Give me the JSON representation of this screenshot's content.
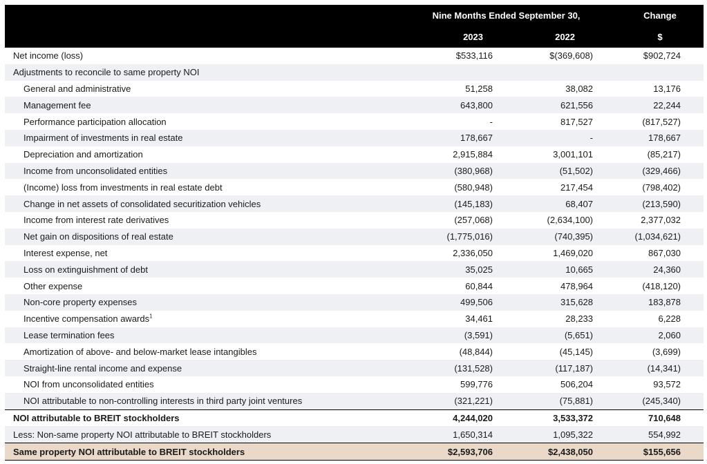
{
  "header": {
    "period_label": "Nine Months Ended September 30,",
    "change_label": "Change",
    "year_1": "2023",
    "year_2": "2022",
    "change_unit": "$"
  },
  "rows": [
    {
      "label": "Net income (loss)",
      "v2023": "$533,116",
      "v2022": "$(369,608)",
      "change": "$902,724"
    },
    {
      "label": "Adjustments to reconcile to same property NOI",
      "v2023": "",
      "v2022": "",
      "change": ""
    },
    {
      "label": "General and administrative",
      "v2023": "51,258",
      "v2022": "38,082",
      "change": "13,176"
    },
    {
      "label": "Management fee",
      "v2023": "643,800",
      "v2022": "621,556",
      "change": "22,244"
    },
    {
      "label": "Performance participation allocation",
      "v2023": "-",
      "v2022": "817,527",
      "change": "(817,527)"
    },
    {
      "label": "Impairment of investments in real estate",
      "v2023": "178,667",
      "v2022": "-",
      "change": "178,667"
    },
    {
      "label": "Depreciation and amortization",
      "v2023": "2,915,884",
      "v2022": "3,001,101",
      "change": "(85,217)"
    },
    {
      "label": "Income from unconsolidated entities",
      "v2023": "(380,968)",
      "v2022": "(51,502)",
      "change": "(329,466)"
    },
    {
      "label": "(Income) loss from investments in real estate debt",
      "v2023": "(580,948)",
      "v2022": "217,454",
      "change": "(798,402)"
    },
    {
      "label": "Change in net assets of consolidated securitization vehicles",
      "v2023": "(145,183)",
      "v2022": "68,407",
      "change": "(213,590)"
    },
    {
      "label": "Income from interest rate derivatives",
      "v2023": "(257,068)",
      "v2022": "(2,634,100)",
      "change": "2,377,032"
    },
    {
      "label": "Net gain on dispositions of real estate",
      "v2023": "(1,775,016)",
      "v2022": "(740,395)",
      "change": "(1,034,621)"
    },
    {
      "label": "Interest expense, net",
      "v2023": "2,336,050",
      "v2022": "1,469,020",
      "change": "867,030"
    },
    {
      "label": "Loss on extinguishment of debt",
      "v2023": "35,025",
      "v2022": "10,665",
      "change": "24,360"
    },
    {
      "label": "Other expense",
      "v2023": "60,844",
      "v2022": "478,964",
      "change": "(418,120)"
    },
    {
      "label": "Non-core property expenses",
      "v2023": "499,506",
      "v2022": "315,628",
      "change": "183,878"
    },
    {
      "label": "Incentive compensation awards",
      "footnote": "1",
      "v2023": "34,461",
      "v2022": "28,233",
      "change": "6,228"
    },
    {
      "label": "Lease termination fees",
      "v2023": "(3,591)",
      "v2022": "(5,651)",
      "change": "2,060"
    },
    {
      "label": "Amortization of above- and below-market lease intangibles",
      "v2023": "(48,844)",
      "v2022": "(45,145)",
      "change": "(3,699)"
    },
    {
      "label": "Straight-line rental income and expense",
      "v2023": "(131,528)",
      "v2022": "(117,187)",
      "change": "(14,341)"
    },
    {
      "label": "NOI from unconsolidated entities",
      "v2023": "599,776",
      "v2022": "506,204",
      "change": "93,572"
    },
    {
      "label": "NOI attributable to non-controlling interests in third party joint ventures",
      "v2023": "(321,221)",
      "v2022": "(75,881)",
      "change": "(245,340)"
    },
    {
      "label": "NOI attributable to BREIT stockholders",
      "v2023": "4,244,020",
      "v2022": "3,533,372",
      "change": "710,648"
    },
    {
      "label": "Less: Non-same property NOI attributable to BREIT stockholders",
      "v2023": "1,650,314",
      "v2022": "1,095,322",
      "change": "554,992"
    },
    {
      "label": "Same property NOI attributable to BREIT stockholders",
      "v2023": "$2,593,706",
      "v2022": "$2,438,050",
      "change": "$155,656"
    }
  ]
}
